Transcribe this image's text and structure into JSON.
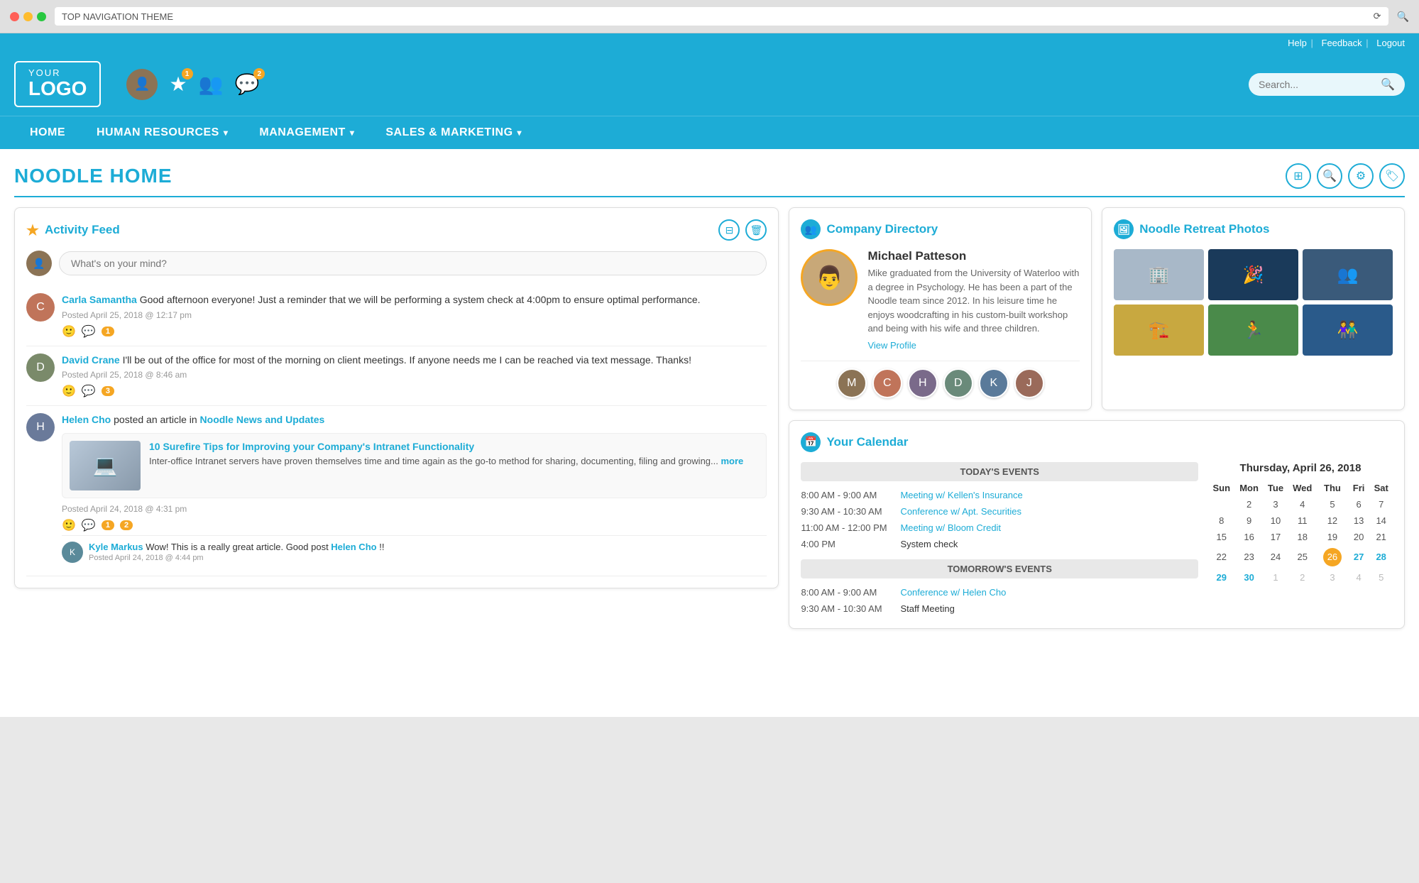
{
  "browser": {
    "title": "TOP NAVIGATION THEME",
    "search_placeholder": "Search..."
  },
  "utility_bar": {
    "help": "Help",
    "feedback": "Feedback",
    "logout": "Logout"
  },
  "header": {
    "logo_your": "YOUR",
    "logo_logo": "LOGO",
    "search_placeholder": "Search...",
    "icons": {
      "star_badge": "1",
      "chat_badge": "2"
    }
  },
  "nav": {
    "items": [
      {
        "label": "HOME",
        "has_arrow": false
      },
      {
        "label": "HUMAN RESOURCES",
        "has_arrow": true
      },
      {
        "label": "MANAGEMENT",
        "has_arrow": true
      },
      {
        "label": "SALES & MARKETING",
        "has_arrow": true
      }
    ]
  },
  "page": {
    "title": "NOODLE HOME"
  },
  "activity_feed": {
    "title": "Activity Feed",
    "post_placeholder": "What's on your mind?",
    "posts": [
      {
        "name": "Carla Samantha",
        "text": "Good afternoon everyone! Just a reminder that we will be performing a system check at 4:00pm to ensure optimal performance.",
        "meta": "Posted April 25, 2018 @ 12:17 pm",
        "like_count": "1"
      },
      {
        "name": "David Crane",
        "text": "I'll be out of the office for most of the morning on client meetings. If anyone needs me I can be reached via text message. Thanks!",
        "meta": "Posted April 25, 2018 @ 8:46 am",
        "like_count": "3"
      },
      {
        "name": "Helen Cho",
        "posted_in": "Noodle News and Updates",
        "article_title": "10 Surefire Tips for Improving your Company's Intranet Functionality",
        "article_body": "Inter-office Intranet servers have proven themselves time and time again as the go-to method for sharing, documenting, filing and growing...",
        "article_more": "more",
        "meta": "Posted April 24, 2018 @ 4:31 pm",
        "like_count": "2",
        "comment_count": "1",
        "comment": {
          "name": "Kyle Markus",
          "text": "Wow! This is a really great article. Good post ",
          "mention": "Helen Cho",
          "suffix": "!!",
          "meta": "Posted April 24, 2018 @ 4:44 pm"
        }
      }
    ]
  },
  "company_directory": {
    "title": "Company Directory",
    "featured": {
      "name": "Michael Patteson",
      "bio": "Mike graduated from the University of Waterloo with a degree in Psychology. He has been a part of the Noodle team since 2012. In his leisure time he enjoys woodcrafting in his custom-built workshop and being with his wife and three children.",
      "view_profile": "View Profile"
    },
    "avatars": [
      {
        "color": "#8b7355",
        "initial": "M"
      },
      {
        "color": "#c0745a",
        "initial": "C"
      },
      {
        "color": "#7a6a8a",
        "initial": "H"
      },
      {
        "color": "#6a8a7a",
        "initial": "D"
      },
      {
        "color": "#5a7a9a",
        "initial": "K"
      },
      {
        "color": "#9a6a5a",
        "initial": "J"
      }
    ]
  },
  "photos": {
    "title": "Noodle Retreat Photos",
    "items": [
      {
        "bg": "#a8b8c8",
        "emoji": "🏢"
      },
      {
        "bg": "#2a4a6a",
        "emoji": "🎉"
      },
      {
        "bg": "#4a6a8a",
        "emoji": "👥"
      },
      {
        "bg": "#c8a840",
        "emoji": "🏗️"
      },
      {
        "bg": "#4a8a4a",
        "emoji": "🏃"
      },
      {
        "bg": "#2a6a8a",
        "emoji": "👫"
      }
    ]
  },
  "calendar": {
    "title": "Your Calendar",
    "today_label": "TODAY'S EVENTS",
    "tomorrow_label": "TOMORROW'S EVENTS",
    "today_events": [
      {
        "time": "8:00 AM - 9:00 AM",
        "label": "Meeting w/ Kellen's Insurance",
        "is_link": true
      },
      {
        "time": "9:30 AM - 10:30 AM",
        "label": "Conference w/ Apt. Securities",
        "is_link": true
      },
      {
        "time": "11:00 AM - 12:00 PM",
        "label": "Meeting w/ Bloom Credit",
        "is_link": true
      },
      {
        "time": "4:00 PM",
        "label": "System check",
        "is_link": false
      }
    ],
    "tomorrow_events": [
      {
        "time": "8:00 AM - 9:00 AM",
        "label": "Conference w/ Helen Cho",
        "is_link": true
      },
      {
        "time": "9:30 AM - 10:30 AM",
        "label": "Staff Meeting",
        "is_link": false
      }
    ],
    "mini_cal": {
      "month_year": "Thursday, April 26, 2018",
      "headers": [
        "Sun",
        "Mon",
        "Tue",
        "Wed",
        "Thu",
        "Fri",
        "Sat"
      ],
      "weeks": [
        [
          "",
          "2",
          "3",
          "4",
          "5",
          "6",
          "7"
        ],
        [
          "8",
          "9",
          "10",
          "11",
          "12",
          "13",
          "14"
        ],
        [
          "15",
          "16",
          "17",
          "18",
          "19",
          "20",
          "21"
        ],
        [
          "22",
          "23",
          "24",
          "25",
          "26",
          "27",
          "28"
        ],
        [
          "29",
          "30",
          "1",
          "2",
          "3",
          "4",
          "5"
        ]
      ],
      "today": "26",
      "highlights": [
        "27",
        "28"
      ],
      "other_month": [
        "1",
        "2",
        "3",
        "4",
        "5"
      ]
    }
  }
}
